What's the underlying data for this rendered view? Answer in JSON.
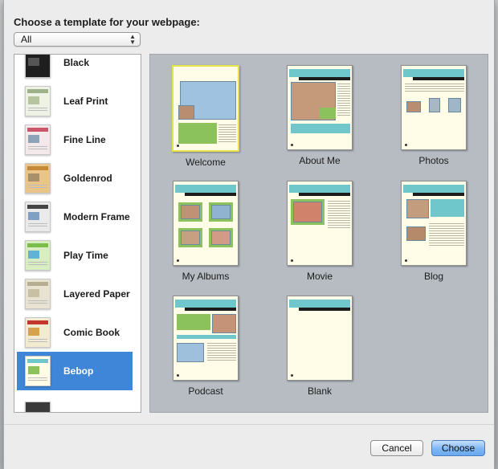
{
  "dialog": {
    "prompt": "Choose a template for your webpage:",
    "category_selected": "All"
  },
  "themes": [
    {
      "label": "Black",
      "color": "#1e1e1e"
    },
    {
      "label": "Leaf Print",
      "color": "#eef2e4"
    },
    {
      "label": "Fine Line",
      "color": "#f3e8ea"
    },
    {
      "label": "Goldenrod",
      "color": "#e9c58a"
    },
    {
      "label": "Modern Frame",
      "color": "#eaeaea"
    },
    {
      "label": "Play Time",
      "color": "#d9edc3"
    },
    {
      "label": "Layered Paper",
      "color": "#e8e2d0"
    },
    {
      "label": "Comic Book",
      "color": "#f3ead2"
    },
    {
      "label": "Bebop",
      "color": "#6fc7cc",
      "selected": true
    }
  ],
  "templates": [
    {
      "label": "Welcome",
      "selected": true
    },
    {
      "label": "About Me"
    },
    {
      "label": "Photos"
    },
    {
      "label": "My Albums"
    },
    {
      "label": "Movie"
    },
    {
      "label": "Blog"
    },
    {
      "label": "Podcast"
    },
    {
      "label": "Blank"
    }
  ],
  "buttons": {
    "cancel": "Cancel",
    "choose": "Choose"
  },
  "colors": {
    "selection_blue": "#3f86d9",
    "gallery_bg": "#b7bcc3",
    "template_header": "#6fc7cc"
  }
}
